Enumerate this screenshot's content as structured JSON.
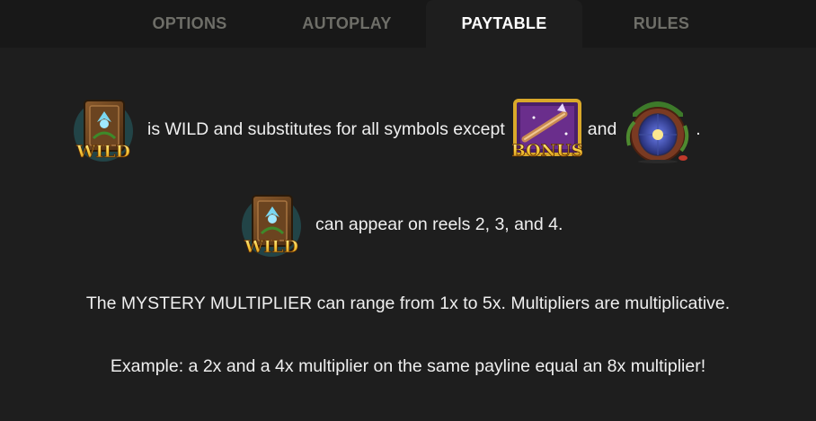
{
  "tabs": [
    {
      "label": "OPTIONS",
      "active": false
    },
    {
      "label": "AUTOPLAY",
      "active": false
    },
    {
      "label": "PAYTABLE",
      "active": true
    },
    {
      "label": "RULES",
      "active": false
    }
  ],
  "symbols": {
    "wild_label": "WILD",
    "bonus_label": "BONUS",
    "scatter_icon": "fairy-door-icon"
  },
  "paytable": {
    "wild_rule_text": "is WILD and substitutes for all symbols except",
    "wild_rule_and": "and",
    "wild_rule_end": ".",
    "wild_reels_text": "can appear on reels 2, 3, and 4.",
    "multiplier_text": "The MYSTERY MULTIPLIER can range from 1x to 5x. Multipliers are multiplicative.",
    "example_text": "Example: a 2x and a 4x multiplier on the same payline equal an 8x multiplier!"
  },
  "colors": {
    "background": "#1e1e1e",
    "tabbar": "#181818",
    "tab_inactive": "#6e6e68",
    "tab_active": "#ffffff",
    "wild_text": "#f6c83a",
    "bonus_frame": "#d9a82a"
  }
}
